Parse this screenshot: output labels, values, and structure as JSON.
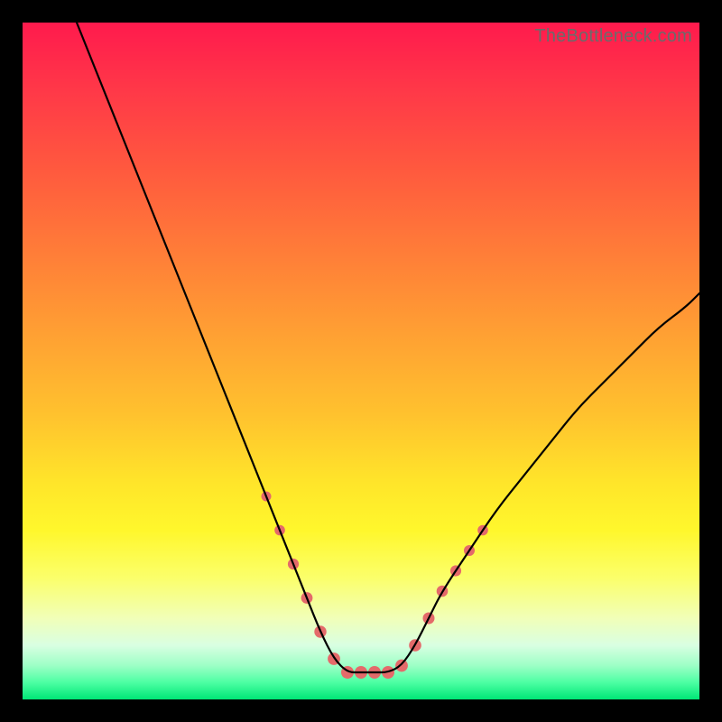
{
  "watermark": "TheBottleneck.com",
  "chart_data": {
    "type": "line",
    "title": "",
    "xlabel": "",
    "ylabel": "",
    "xlim": [
      0,
      100
    ],
    "ylim": [
      0,
      100
    ],
    "grid": false,
    "legend": false,
    "description": "Bottleneck-style V-curve over a vertical red-yellow-green gradient; minimum plateau around x≈47–55 at y≈4; left arm rises steeply to y=100 at x≈8; right arm rises to y≈60 at x=100.",
    "series": [
      {
        "name": "curve",
        "color": "#000000",
        "x": [
          8,
          12,
          16,
          20,
          24,
          28,
          32,
          36,
          38,
          40,
          42,
          44,
          46,
          48,
          50,
          52,
          54,
          56,
          58,
          60,
          62,
          66,
          70,
          74,
          78,
          82,
          86,
          90,
          94,
          98,
          100
        ],
        "y": [
          100,
          90,
          80,
          70,
          60,
          50,
          40,
          30,
          25,
          20,
          15,
          10,
          6,
          4,
          4,
          4,
          4,
          5,
          8,
          12,
          16,
          22,
          28,
          33,
          38,
          43,
          47,
          51,
          55,
          58,
          60
        ]
      }
    ],
    "markers": {
      "name": "highlight-dots",
      "color": "#e46a6a",
      "radius_range": [
        4,
        7
      ],
      "points": [
        {
          "x": 36,
          "y": 30
        },
        {
          "x": 38,
          "y": 25
        },
        {
          "x": 40,
          "y": 20
        },
        {
          "x": 42,
          "y": 15
        },
        {
          "x": 44,
          "y": 10
        },
        {
          "x": 46,
          "y": 6
        },
        {
          "x": 48,
          "y": 4
        },
        {
          "x": 50,
          "y": 4
        },
        {
          "x": 52,
          "y": 4
        },
        {
          "x": 54,
          "y": 4
        },
        {
          "x": 56,
          "y": 5
        },
        {
          "x": 58,
          "y": 8
        },
        {
          "x": 60,
          "y": 12
        },
        {
          "x": 62,
          "y": 16
        },
        {
          "x": 64,
          "y": 19
        },
        {
          "x": 66,
          "y": 22
        },
        {
          "x": 68,
          "y": 25
        }
      ]
    },
    "gradient_stops": [
      {
        "pos": 0,
        "color": "#ff1a4d"
      },
      {
        "pos": 10,
        "color": "#ff3848"
      },
      {
        "pos": 22,
        "color": "#ff5a3e"
      },
      {
        "pos": 34,
        "color": "#ff7d38"
      },
      {
        "pos": 46,
        "color": "#ffa033"
      },
      {
        "pos": 58,
        "color": "#ffc22e"
      },
      {
        "pos": 68,
        "color": "#ffe52a"
      },
      {
        "pos": 75,
        "color": "#fff72c"
      },
      {
        "pos": 82,
        "color": "#fbff6a"
      },
      {
        "pos": 88,
        "color": "#f1ffb8"
      },
      {
        "pos": 92,
        "color": "#d9ffe2"
      },
      {
        "pos": 95,
        "color": "#9dffc6"
      },
      {
        "pos": 97.5,
        "color": "#4cffa3"
      },
      {
        "pos": 100,
        "color": "#00e676"
      }
    ]
  }
}
